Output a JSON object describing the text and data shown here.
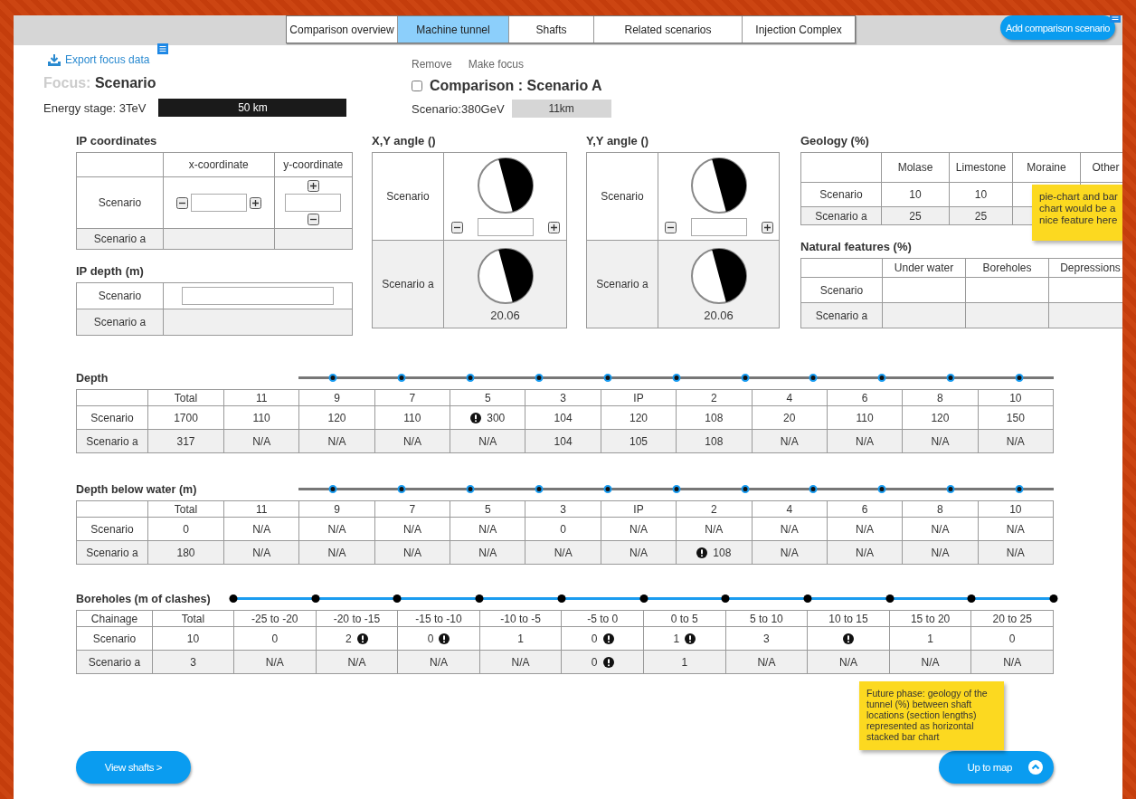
{
  "tabs": [
    {
      "label": "Comparison overview",
      "selected": false
    },
    {
      "label": "Machine tunnel",
      "selected": true
    },
    {
      "label": "Shafts",
      "selected": false
    },
    {
      "label": "Related scenarios",
      "selected": false
    },
    {
      "label": "Injection Complex",
      "selected": false
    }
  ],
  "add_button": "Add comparison scenario",
  "focus": {
    "export_link": "Export focus data",
    "label": "Focus:",
    "name": "Scenario",
    "energy_stage": "Energy stage: 3TeV",
    "length": "50 km"
  },
  "comparison": {
    "actions": [
      "Remove",
      "Make focus"
    ],
    "checked": false,
    "title": "Comparison : Scenario A",
    "scenario": "Scenario:380GeV",
    "length": "11km"
  },
  "ip_coordinates": {
    "title": "IP coordinates",
    "columns": [
      "x-coordinate",
      "y-coordinate"
    ],
    "rows": [
      "Scenario",
      "Scenario a"
    ]
  },
  "ip_depth": {
    "title": "IP depth (m)",
    "rows": [
      "Scenario",
      "Scenario a"
    ]
  },
  "angles": [
    {
      "title": "X,Y  angle ()",
      "rows": [
        "Scenario",
        "Scenario a"
      ],
      "value": "20.06"
    },
    {
      "title": "Y,Y angle ()",
      "rows": [
        "Scenario",
        "Scenario a"
      ],
      "value": "20.06"
    }
  ],
  "geology": {
    "title": "Geology (%)",
    "columns": [
      "Molase",
      "Limestone",
      "Moraine",
      "Other"
    ],
    "rows": [
      {
        "label": "Scenario",
        "cells": [
          "10",
          "10"
        ]
      },
      {
        "label": "Scenario a",
        "cells": [
          "25",
          "25"
        ]
      }
    ],
    "note": "pie-chart and bar chart would be a nice feature here"
  },
  "natural_features": {
    "title": "Natural features (%)",
    "columns": [
      "Under water",
      "Boreholes",
      "Depressions"
    ],
    "rows": [
      "Scenario",
      "Scenario a"
    ]
  },
  "sections": [
    {
      "title": "Depth",
      "kind": "centers",
      "columns": [
        "Total",
        "11",
        "9",
        "7",
        "5",
        "3",
        "IP",
        "2",
        "4",
        "6",
        "8",
        "10"
      ],
      "rows": [
        {
          "label": "Scenario",
          "cells": [
            {
              "text": "1700",
              "warning": false
            },
            {
              "text": "110",
              "warning": false
            },
            {
              "text": "120",
              "warning": false
            },
            {
              "text": "110",
              "warning": false
            },
            {
              "text": "300",
              "warning": true
            },
            {
              "text": "104",
              "warning": false
            },
            {
              "text": "120",
              "warning": false
            },
            {
              "text": "108",
              "warning": false
            },
            {
              "text": "20",
              "warning": false
            },
            {
              "text": "110",
              "warning": false
            },
            {
              "text": "120",
              "warning": false
            },
            {
              "text": "150",
              "warning": false
            }
          ]
        },
        {
          "label": "Scenario a",
          "cells": [
            {
              "text": "317",
              "warning": false
            },
            {
              "text": "N/A",
              "warning": false
            },
            {
              "text": "N/A",
              "warning": false
            },
            {
              "text": "N/A",
              "warning": false
            },
            {
              "text": "N/A",
              "warning": false
            },
            {
              "text": "104",
              "warning": false
            },
            {
              "text": "105",
              "warning": false
            },
            {
              "text": "108",
              "warning": false
            },
            {
              "text": "N/A",
              "warning": false
            },
            {
              "text": "N/A",
              "warning": false
            },
            {
              "text": "N/A",
              "warning": false
            },
            {
              "text": "N/A",
              "warning": false
            }
          ]
        }
      ]
    },
    {
      "title": "Depth below water (m)",
      "kind": "centers",
      "columns": [
        "Total",
        "11",
        "9",
        "7",
        "5",
        "3",
        "IP",
        "2",
        "4",
        "6",
        "8",
        "10"
      ],
      "rows": [
        {
          "label": "Scenario",
          "cells": [
            {
              "text": "0",
              "warning": false
            },
            {
              "text": "N/A",
              "warning": false
            },
            {
              "text": "N/A",
              "warning": false
            },
            {
              "text": "N/A",
              "warning": false
            },
            {
              "text": "N/A",
              "warning": false
            },
            {
              "text": "0",
              "warning": false
            },
            {
              "text": "N/A",
              "warning": false
            },
            {
              "text": "N/A",
              "warning": false
            },
            {
              "text": "N/A",
              "warning": false
            },
            {
              "text": "N/A",
              "warning": false
            },
            {
              "text": "N/A",
              "warning": false
            },
            {
              "text": "N/A",
              "warning": false
            }
          ]
        },
        {
          "label": "Scenario a",
          "cells": [
            {
              "text": "180",
              "warning": false
            },
            {
              "text": "N/A",
              "warning": false
            },
            {
              "text": "N/A",
              "warning": false
            },
            {
              "text": "N/A",
              "warning": false
            },
            {
              "text": "N/A",
              "warning": false
            },
            {
              "text": "N/A",
              "warning": false
            },
            {
              "text": "N/A",
              "warning": false
            },
            {
              "text": "108",
              "warning": true
            },
            {
              "text": "N/A",
              "warning": false
            },
            {
              "text": "N/A",
              "warning": false
            },
            {
              "text": "N/A",
              "warning": false
            },
            {
              "text": "N/A",
              "warning": false
            }
          ]
        }
      ]
    },
    {
      "title": "Boreholes (m of clashes)",
      "kind": "boundaries",
      "corner": "Chainage",
      "columns": [
        "Total",
        "-25 to -20",
        "-20 to -15",
        "-15 to -10",
        "-10 to -5",
        "-5 to 0",
        "0 to 5",
        "5 to 10",
        "10 to 15",
        "15 to 20",
        "20 to 25"
      ],
      "rows": [
        {
          "label": "Scenario",
          "cells": [
            {
              "text": "10",
              "warning": false
            },
            {
              "text": "0",
              "warning": false
            },
            {
              "text": "2",
              "warning": true
            },
            {
              "text": "0",
              "warning": true
            },
            {
              "text": "1",
              "warning": false
            },
            {
              "text": "0",
              "warning": true
            },
            {
              "text": "1",
              "warning": true
            },
            {
              "text": "3",
              "warning": false
            },
            {
              "warning": true
            },
            {
              "text": "1",
              "warning": false
            },
            {
              "text": "0",
              "warning": false
            }
          ]
        },
        {
          "label": "Scenario a",
          "cells": [
            {
              "text": "3",
              "warning": false
            },
            {
              "text": "N/A",
              "warning": false
            },
            {
              "text": "N/A",
              "warning": false
            },
            {
              "text": "N/A",
              "warning": false
            },
            {
              "text": "N/A",
              "warning": false
            },
            {
              "text": "0",
              "warning": true
            },
            {
              "text": "1",
              "warning": false
            },
            {
              "text": "N/A",
              "warning": false
            },
            {
              "text": "N/A",
              "warning": false
            },
            {
              "text": "N/A",
              "warning": false
            },
            {
              "text": "N/A",
              "warning": false
            }
          ]
        }
      ]
    }
  ],
  "future_note": "Future phase: geology of the tunnel (%) between shaft locations (section lengths) represented as horizontal stacked bar chart",
  "buttons": {
    "view_shafts": "View shafts >",
    "up_to_map": "Up to map"
  }
}
